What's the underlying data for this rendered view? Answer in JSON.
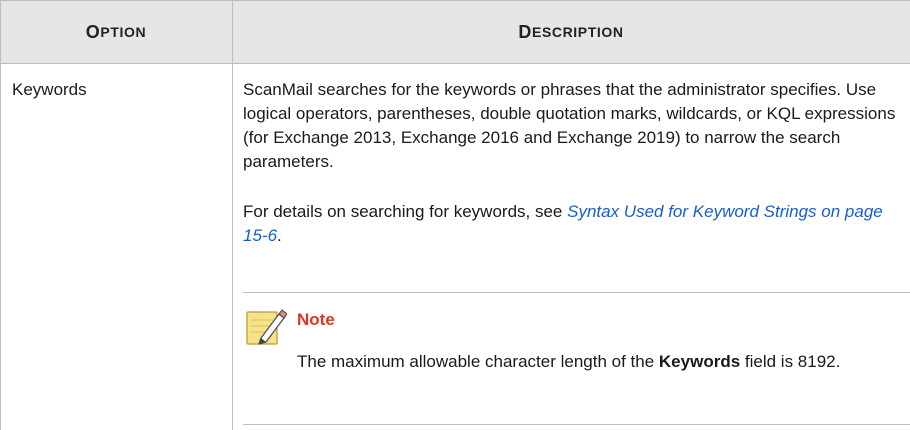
{
  "table": {
    "headers": {
      "option": [
        "O",
        "PTION"
      ],
      "description": [
        "D",
        "ESCRIPTION"
      ]
    },
    "row": {
      "option": "Keywords",
      "paragraph1": "ScanMail searches for the keywords or phrases that the administrator specifies. Use logical operators, parentheses, double quotation marks, wildcards, or KQL expressions (for Exchange 2013, Exchange 2016 and Exchange 2019) to narrow the search parameters.",
      "paragraph2_prefix": "For details on searching for keywords, see ",
      "paragraph2_link": "Syntax Used for Keyword Strings on page 15-6",
      "paragraph2_suffix": ".",
      "note": {
        "title": "Note",
        "body_prefix": "The maximum allowable character length of the ",
        "body_bold": "Keywords",
        "body_suffix": " field is 8192.",
        "icon": "note-pencil-icon"
      }
    }
  },
  "colors": {
    "header_bg": "#e6e6e6",
    "link": "#1a5ccc",
    "note_title": "#d83a1e"
  }
}
